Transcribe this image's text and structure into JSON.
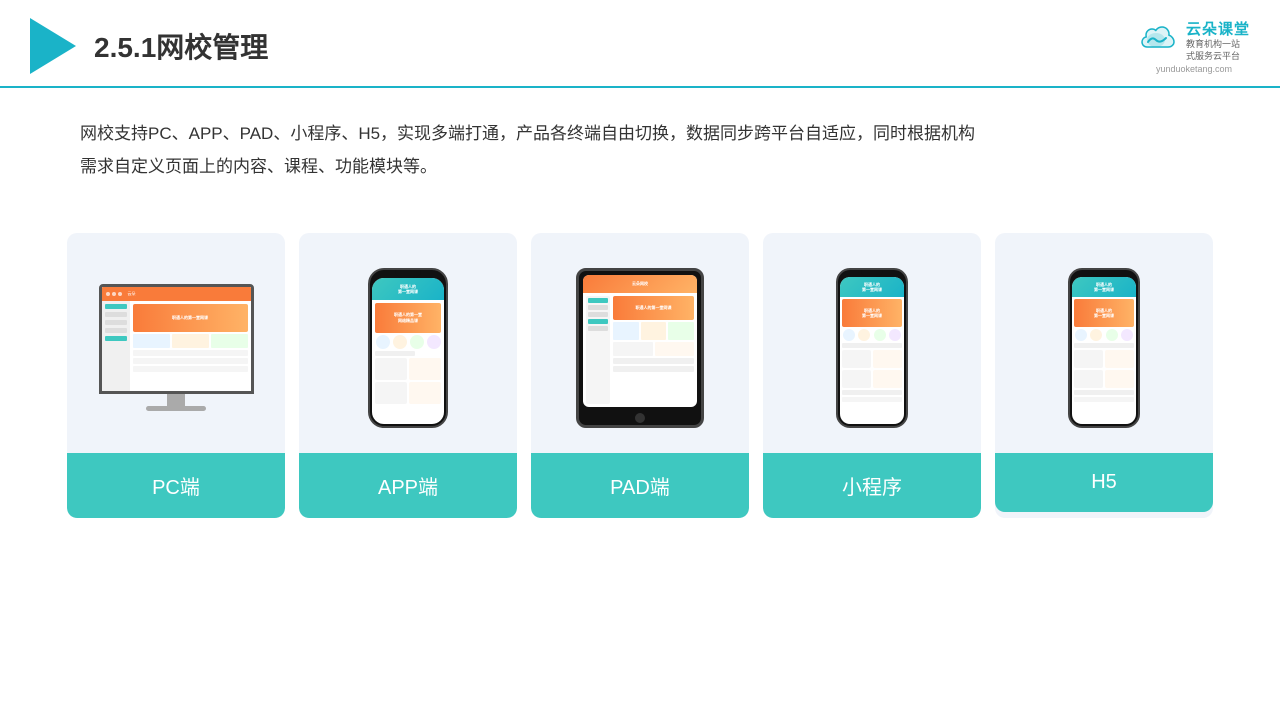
{
  "header": {
    "title": "2.5.1网校管理",
    "brand": {
      "name": "云朵课堂",
      "slogan": "教育机构一站\n式服务云平台",
      "url": "yunduoketang.com"
    }
  },
  "description": {
    "text": "网校支持PC、APP、PAD、小程序、H5，实现多端打通，产品各终端自由切换，数据同步跨平台自适应，同时根据机构需求自定义页面上的内容、课程、功能模块等。"
  },
  "cards": [
    {
      "id": "pc",
      "label": "PC端"
    },
    {
      "id": "app",
      "label": "APP端"
    },
    {
      "id": "pad",
      "label": "PAD端"
    },
    {
      "id": "miniprogram",
      "label": "小程序"
    },
    {
      "id": "h5",
      "label": "H5"
    }
  ],
  "colors": {
    "accent": "#1ab3c8",
    "teal": "#3ec8c0",
    "orange": "#f97b3a",
    "bg_card": "#f0f4fa",
    "text_dark": "#333333"
  }
}
